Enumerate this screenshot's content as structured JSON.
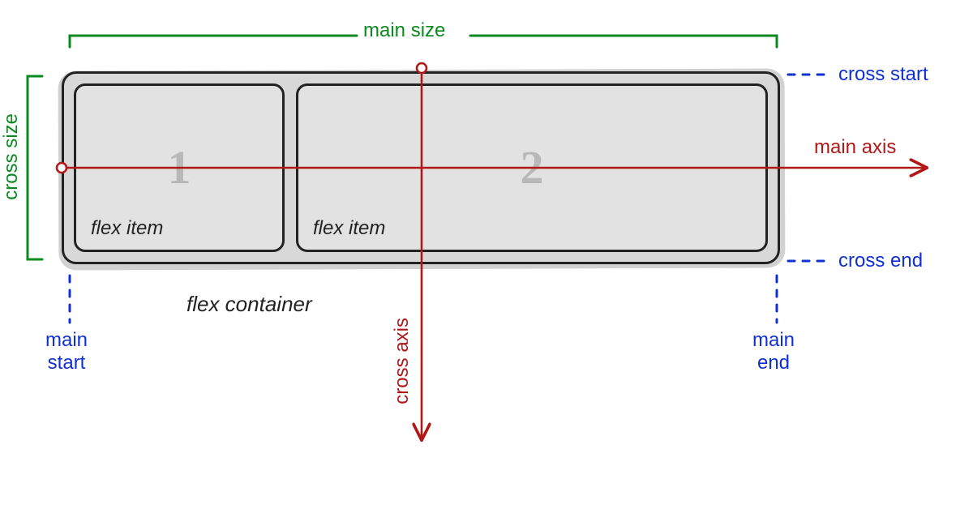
{
  "labels": {
    "main_size": "main size",
    "cross_size": "cross size",
    "main_axis": "main axis",
    "cross_axis": "cross axis",
    "main_start": "main\nstart",
    "main_end": "main\nend",
    "cross_start": "cross start",
    "cross_end": "cross end",
    "flex_container": "flex container",
    "flex_item": "flex item"
  },
  "items": {
    "one": "1",
    "two": "2"
  },
  "colors": {
    "green": "#0a8a1f",
    "blue": "#1030d0",
    "red": "#b11818",
    "ink": "#222222",
    "item_bg": "#e2e2e2",
    "container_bg": "#d8d8d8"
  }
}
